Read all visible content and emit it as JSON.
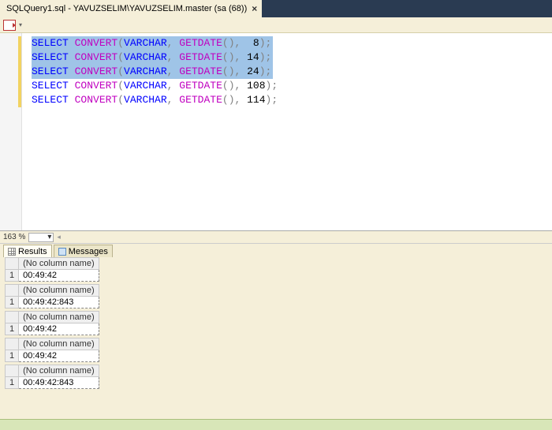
{
  "tab": {
    "title": "SQLQuery1.sql - YAVUZSELIM\\YAVUZSELIM.master (sa (68))"
  },
  "zoom": {
    "value": "163 %"
  },
  "code": {
    "lines": [
      {
        "style": 8,
        "selected": true
      },
      {
        "style": 14,
        "selected": true
      },
      {
        "style": 24,
        "selected": true
      },
      {
        "style": 108,
        "selected": false
      },
      {
        "style": 114,
        "selected": false
      }
    ],
    "kw_select": "SELECT",
    "fn_convert": "CONVERT",
    "ty_varchar": "VARCHAR",
    "fn_getdate": "GETDATE"
  },
  "resultTabs": {
    "results": "Results",
    "messages": "Messages"
  },
  "results": [
    {
      "header": "(No column name)",
      "row": "1",
      "value": "00:49:42"
    },
    {
      "header": "(No column name)",
      "row": "1",
      "value": "00:49:42:843"
    },
    {
      "header": "(No column name)",
      "row": "1",
      "value": "00:49:42"
    },
    {
      "header": "(No column name)",
      "row": "1",
      "value": "00:49:42"
    },
    {
      "header": "(No column name)",
      "row": "1",
      "value": "00:49:42:843"
    }
  ]
}
